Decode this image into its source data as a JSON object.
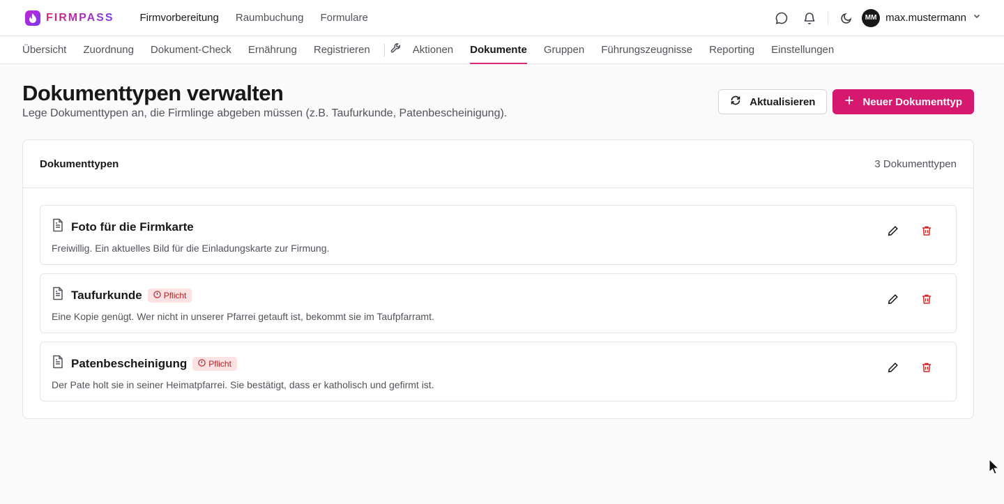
{
  "app": {
    "brand": "FIRMPASS",
    "main_nav": [
      "Firmvorbereitung",
      "Raumbuchung",
      "Formulare"
    ],
    "user": {
      "initials": "MM",
      "name": "max.mustermann"
    }
  },
  "subnav": {
    "tabs_left": [
      "Übersicht",
      "Zuordnung",
      "Dokument-Check",
      "Ernährung",
      "Registrieren"
    ],
    "tabs_right": [
      "Aktionen",
      "Dokumente",
      "Gruppen",
      "Führungszeugnisse",
      "Reporting",
      "Einstellungen"
    ],
    "active": "Dokumente"
  },
  "page": {
    "title": "Dokumenttypen verwalten",
    "subtitle": "Lege Dokumenttypen an, die Firmlinge abgeben müssen (z.B. Taufurkunde, Patenbescheinigung).",
    "refresh_label": "Aktualisieren",
    "new_label": "Neuer Dokumenttyp"
  },
  "card": {
    "title": "Dokumenttypen",
    "count": "3 Dokumenttypen",
    "items": [
      {
        "name": "Foto für die Firmkarte",
        "badge": "",
        "description": "Freiwillig. Ein aktuelles Bild für die Einladungskarte zur Firmung."
      },
      {
        "name": "Taufurkunde",
        "badge": "Pflicht",
        "description": "Eine Kopie genügt. Wer nicht in unserer Pfarrei getauft ist, bekommt sie im Taufpfarramt."
      },
      {
        "name": "Patenbescheinigung",
        "badge": "Pflicht",
        "description": "Der Pate holt sie in seiner Heimatpfarrei. Sie bestätigt, dass er katholisch und gefirmt ist."
      }
    ]
  },
  "colors": {
    "accent": "#d6186f",
    "danger": "#dc2626",
    "badge_bg": "#fde2e4"
  }
}
